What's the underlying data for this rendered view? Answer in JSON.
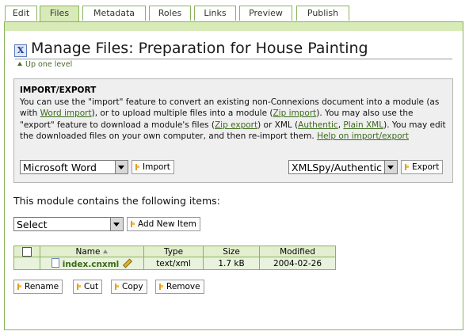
{
  "tabs": [
    "Edit",
    "Files",
    "Metadata",
    "Roles",
    "Links",
    "Preview",
    "Publish"
  ],
  "active_tab": "Files",
  "page": {
    "title": "Manage Files: Preparation for House Painting",
    "up_level": "Up one level"
  },
  "import_export": {
    "heading": "IMPORT/EXPORT",
    "text_1": "You can use the \"import\" feature to convert an existing non-Connexions document into a module (as with ",
    "link_word_import": "Word import",
    "text_2": "), or to upload multiple files into a module (",
    "link_zip_import": "Zip import",
    "text_3": "). You may also use the \"export\" feature to download a module's files (",
    "link_zip_export": "Zip export",
    "text_4": ") or XML (",
    "link_authentic": "Authentic",
    "text_5": ", ",
    "link_plain_xml": "Plain XML",
    "text_6": "). You may edit the downloaded files on your own computer, and then re-import them. ",
    "link_help": "Help on import/export",
    "import_select_value": "Microsoft Word",
    "import_button": "Import",
    "export_select_value": "XMLSpy/Authentic",
    "export_button": "Export"
  },
  "contents": {
    "intro": "This module contains the following items:",
    "add_select_value": "Select",
    "add_button": "Add New Item"
  },
  "table": {
    "headers": {
      "name": "Name",
      "type": "Type",
      "size": "Size",
      "modified": "Modified"
    },
    "rows": [
      {
        "name": "index.cnxml",
        "type": "text/xml",
        "size": "1.7 kB",
        "modified": "2004-02-26"
      }
    ]
  },
  "actions": {
    "rename": "Rename",
    "cut": "Cut",
    "copy": "Copy",
    "remove": "Remove"
  },
  "colors": {
    "accent": "#8ab35c",
    "tab_active": "#d8eab8",
    "link": "#3a6b1a"
  },
  "icons": {
    "module": "cnx-module-icon",
    "file": "file-icon",
    "edit": "pencil-icon",
    "button": "action-arrow-icon"
  }
}
